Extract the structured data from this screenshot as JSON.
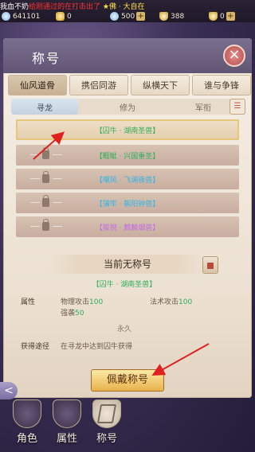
{
  "top": {
    "ticker_segments": [
      {
        "text": "我血不奶",
        "color": "white"
      },
      {
        "text": "给刚通过的在打击出了",
        "color": "red"
      },
      {
        "text": "★佛 · 大自在",
        "color": "yellow"
      }
    ],
    "currencies": [
      {
        "icon": "diamond-icon",
        "value": "641101"
      },
      {
        "icon": "gold-icon",
        "value": "0"
      },
      {
        "icon": "diamond-icon",
        "value": "500"
      },
      {
        "icon": "ingot-icon",
        "value": "388"
      },
      {
        "icon": "ingot-icon",
        "value": "0"
      }
    ],
    "plus_label": "+"
  },
  "panel": {
    "title": "称号",
    "close_label": "×",
    "tabs": [
      "仙风道骨",
      "携侣同游",
      "纵横天下",
      "谁与争锋"
    ],
    "active_tab": 0,
    "subtabs": [
      "寻龙",
      "修为",
      "军衔"
    ],
    "active_subtab": 0,
    "menu_label": "☰"
  },
  "titles": [
    {
      "name": "【囚牛 · 湖南圣兽】",
      "color": "green",
      "locked": false,
      "selected": true
    },
    {
      "name": "【睚眦 · 兴国重圣】",
      "color": "green",
      "locked": true,
      "selected": false
    },
    {
      "name": "【嘲风 · 飞澜夜兽】",
      "color": "blue",
      "locked": true,
      "selected": false
    },
    {
      "name": "【蒲牢 · 朝阳钟兽】",
      "color": "blue",
      "locked": true,
      "selected": false
    },
    {
      "name": "【狻猊 · 麒麟烟兽】",
      "color": "purple",
      "locked": true,
      "selected": false
    }
  ],
  "detail": {
    "current_title": "当前无称号",
    "preview_name": "【囚牛 · 湖南圣兽】",
    "attr_label": "属性",
    "attrs": [
      {
        "name": "物理攻击",
        "value": "100"
      },
      {
        "name": "法术攻击",
        "value": "100"
      },
      {
        "name": "强袭",
        "value": "50"
      }
    ],
    "duration": "永久",
    "obtain_label": "获得途径",
    "obtain_value": "在寻龙中达到囚牛获得",
    "wear_button": "佩戴称号"
  },
  "nav": {
    "items": [
      "角色",
      "属性",
      "称号"
    ],
    "active": 2,
    "side_arrow": "<"
  },
  "colors": {
    "green": "#2fae5a",
    "blue": "#2fb6e8",
    "purple": "#c46be0",
    "annotation": "#e02020"
  }
}
